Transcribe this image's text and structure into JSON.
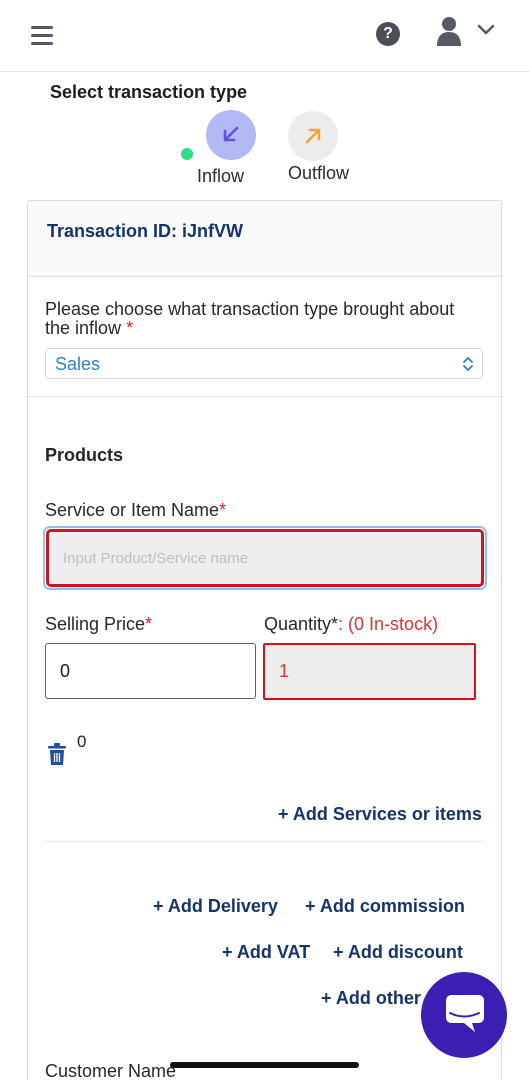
{
  "header": {
    "menu_icon": "hamburger-icon",
    "help_icon": "question-circle-icon",
    "help_symbol": "?",
    "user_icon": "user-icon",
    "dropdown_icon": "chevron-down-icon"
  },
  "transaction_type": {
    "title": "Select transaction type",
    "options": [
      {
        "label": "Inflow",
        "icon": "arrow-down-left-icon",
        "selected": true,
        "color": "#5b54d6"
      },
      {
        "label": "Outflow",
        "icon": "arrow-up-right-icon",
        "selected": false,
        "color": "#f2a23a"
      }
    ]
  },
  "transaction": {
    "id_text": "Transaction ID: iJnfVW"
  },
  "inflow_reason": {
    "question": "Please choose what transaction type brought about the inflow",
    "required_mark": "*",
    "selected_value": "Sales"
  },
  "products": {
    "title": "Products",
    "service_label": "Service or Item Name",
    "required_mark": "*",
    "service_placeholder": "Input Product/Service name",
    "selling_price_label": "Selling Price",
    "selling_price_value": "0",
    "quantity_label": "Quantity*",
    "quantity_stock": ": (0 In-stock)",
    "quantity_value": "1",
    "line_total": "0",
    "add_items_label": "+ Add Services or items"
  },
  "extras": {
    "add_delivery": "+ Add Delivery",
    "add_commission": "+ Add commission",
    "add_vat": "+ Add VAT",
    "add_discount": "+ Add discount",
    "add_other": "+ Add other"
  },
  "customer": {
    "name_label": "Customer Name"
  },
  "chat": {
    "icon": "chat-bubble-icon",
    "color": "#3b1fb2"
  }
}
